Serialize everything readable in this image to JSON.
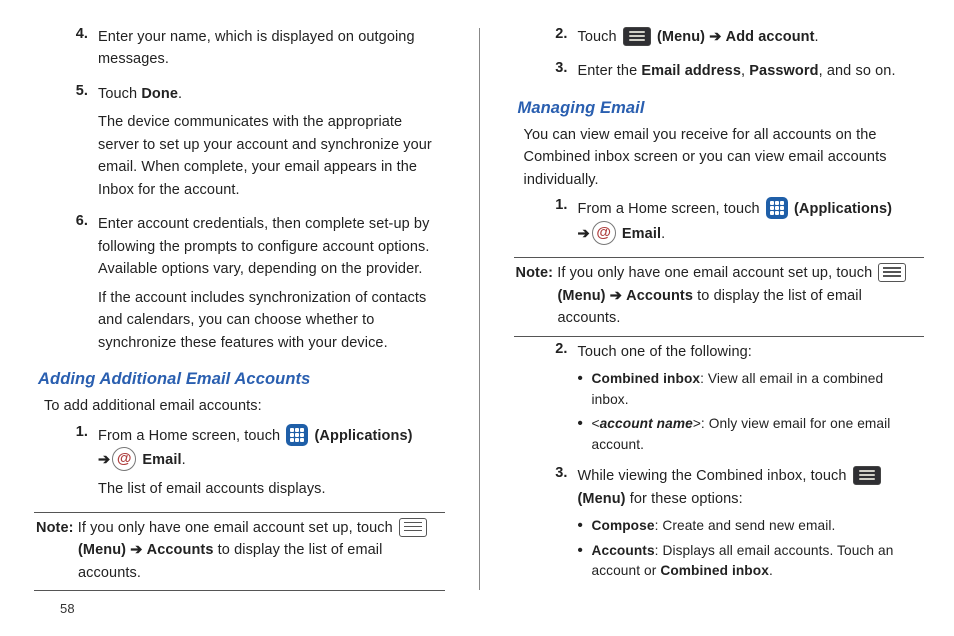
{
  "page_number": "58",
  "left": {
    "steps_a": [
      {
        "n": "4.",
        "lines": [
          "Enter your name, which is displayed on outgoing messages."
        ]
      },
      {
        "n": "5.",
        "lines": [
          "Touch <b>Done</b>.",
          "The device communicates with the appropriate server to set up your account and synchronize your email. When complete, your email appears in the Inbox for the account."
        ]
      },
      {
        "n": "6.",
        "lines": [
          "Enter account credentials, then complete set-up by following the prompts to configure account options. Available options vary, depending on the provider.",
          "If the account includes synchronization of contacts and calendars, you can choose whether to synchronize these features with your device."
        ]
      }
    ],
    "h2": "Adding Additional Email Accounts",
    "intro": "To add additional email accounts:",
    "step1": {
      "n": "1.",
      "line1_a": "From a Home screen, touch ",
      "line1_b": " <b>(Applications)</b> ",
      "line1_arrow": "➔",
      "line1_c": " <b>Email</b>.",
      "line2": "The list of email accounts displays."
    },
    "note": {
      "label": "Note:",
      "a": " If you only have one email account set up, touch ",
      "b": "<b>(Menu)</b> ",
      "arrow": "➔",
      "c": " <b>Accounts</b> to display the list of email accounts."
    }
  },
  "right": {
    "steps_top": [
      {
        "n": "2.",
        "html": "Touch <span class='ico ico-menu-dark' data-name='menu-icon' data-interactable='false'></span> <b>(Menu)</b> <span class='arrow'>➔</span> <b>Add account</b>."
      },
      {
        "n": "3.",
        "html": "Enter the <b>Email address</b>, <b>Password</b>, and so on."
      }
    ],
    "h2": "Managing Email",
    "intro": "You can view email you receive for all accounts on the Combined inbox screen or you can view email accounts individually.",
    "step1": {
      "n": "1.",
      "a": "From a Home screen, touch ",
      "b": " <b>(Applications)</b> ",
      "arrow": "➔",
      "c": " <b>Email</b>."
    },
    "note": {
      "label": "Note:",
      "a": " If you only have one email account set up, touch ",
      "b": "<b>(Menu)</b> ",
      "arrow": "➔",
      "c": " <b>Accounts</b> to display the list of email accounts."
    },
    "step2": {
      "n": "2.",
      "intro": "Touch one of the following:",
      "bullets": [
        "<b>Combined inbox</b>: View all email in a combined inbox.",
        "&lt;<b><i>account name</i></b>&gt;: Only view email for one email account."
      ]
    },
    "step3": {
      "n": "3.",
      "a": "While viewing the Combined inbox, touch ",
      "b": " <b>(Menu)</b> for these options:",
      "bullets": [
        "<b>Compose</b>: Create and send new email.",
        "<b>Accounts</b>: Displays all email accounts. Touch an account or <b>Combined inbox</b>."
      ]
    }
  }
}
